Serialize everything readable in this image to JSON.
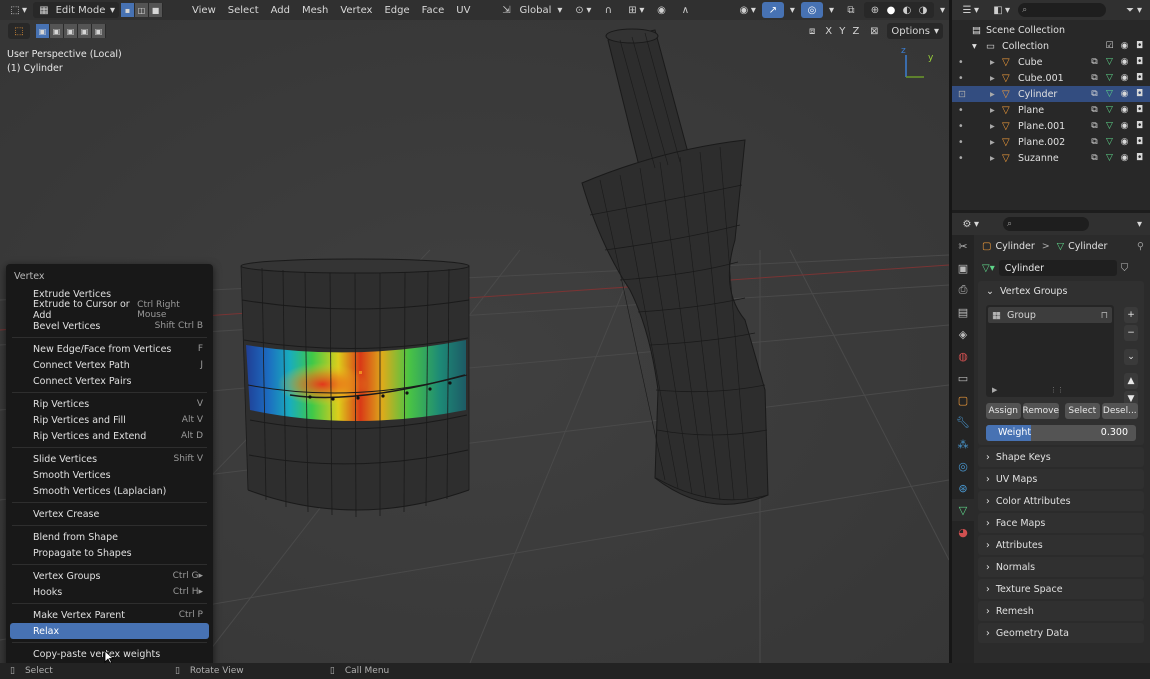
{
  "header": {
    "mode_label": "Edit Mode",
    "menus": [
      "View",
      "Select",
      "Add",
      "Mesh",
      "Vertex",
      "Edge",
      "Face",
      "UV"
    ],
    "transform_orientation": "Global",
    "options_label": "Options",
    "axes_label": "X Y Z"
  },
  "overlay": {
    "perspective": "User Perspective (Local)",
    "object": "(1) Cylinder"
  },
  "context_menu": {
    "title": "Vertex",
    "groups": [
      [
        {
          "label": "Extrude Vertices",
          "shortcut": ""
        },
        {
          "label": "Extrude to Cursor or Add",
          "shortcut": "Ctrl Right Mouse"
        },
        {
          "label": "Bevel Vertices",
          "shortcut": "Shift Ctrl B"
        }
      ],
      [
        {
          "label": "New Edge/Face from Vertices",
          "shortcut": "F"
        },
        {
          "label": "Connect Vertex Path",
          "shortcut": "J"
        },
        {
          "label": "Connect Vertex Pairs",
          "shortcut": ""
        }
      ],
      [
        {
          "label": "Rip Vertices",
          "shortcut": "V"
        },
        {
          "label": "Rip Vertices and Fill",
          "shortcut": "Alt V"
        },
        {
          "label": "Rip Vertices and Extend",
          "shortcut": "Alt D"
        }
      ],
      [
        {
          "label": "Slide Vertices",
          "shortcut": "Shift V"
        },
        {
          "label": "Smooth Vertices",
          "shortcut": ""
        },
        {
          "label": "Smooth Vertices (Laplacian)",
          "shortcut": ""
        }
      ],
      [
        {
          "label": "Vertex Crease",
          "shortcut": ""
        }
      ],
      [
        {
          "label": "Blend from Shape",
          "shortcut": ""
        },
        {
          "label": "Propagate to Shapes",
          "shortcut": ""
        }
      ],
      [
        {
          "label": "Vertex Groups",
          "shortcut": "Ctrl G▸"
        },
        {
          "label": "Hooks",
          "shortcut": "Ctrl H▸"
        }
      ],
      [
        {
          "label": "Make Vertex Parent",
          "shortcut": "Ctrl P"
        },
        {
          "label": "Relax",
          "shortcut": "",
          "selected": true
        }
      ],
      [
        {
          "label": "Copy-paste vertex weights",
          "shortcut": ""
        }
      ]
    ]
  },
  "status_bar": {
    "items": [
      "Select",
      "Rotate View",
      "Call Menu"
    ]
  },
  "outliner": {
    "search_placeholder": "",
    "scene_collection": "Scene Collection",
    "collection": "Collection",
    "objects": [
      {
        "name": "Cube",
        "active": false
      },
      {
        "name": "Cube.001",
        "active": false
      },
      {
        "name": "Cylinder",
        "active": true
      },
      {
        "name": "Plane",
        "active": false
      },
      {
        "name": "Plane.001",
        "active": false
      },
      {
        "name": "Plane.002",
        "active": false
      },
      {
        "name": "Suzanne",
        "active": false
      }
    ]
  },
  "properties": {
    "breadcrumb_object": "Cylinder",
    "breadcrumb_data": "Cylinder",
    "data_name": "Cylinder",
    "vertex_groups_title": "Vertex Groups",
    "group_name": "Group",
    "buttons": {
      "assign": "Assign",
      "remove": "Remove",
      "select": "Select",
      "deselect": "Desel..."
    },
    "weight_label": "Weight",
    "weight_value": "0.300",
    "weight_fraction": 0.3,
    "panels": [
      "Shape Keys",
      "UV Maps",
      "Color Attributes",
      "Face Maps",
      "Attributes",
      "Normals",
      "Texture Space",
      "Remesh",
      "Geometry Data"
    ]
  },
  "colors": {
    "accent": "#4772b3",
    "active_row": "#334d80",
    "mesh_vertex": "#1a1a1a",
    "object_icon": "#ee9a3a",
    "data_icon": "#5fd68a"
  }
}
